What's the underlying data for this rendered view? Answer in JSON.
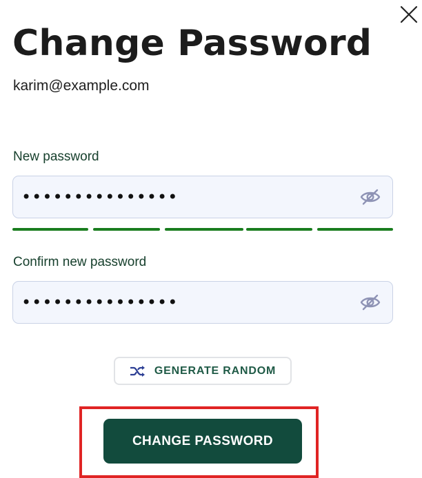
{
  "dialog": {
    "title": "Change Password",
    "email": "karim@example.com",
    "close_icon": "close-icon"
  },
  "new_password": {
    "label": "New password",
    "value": "•••••••••••••••",
    "toggle_icon": "eye-slash-icon"
  },
  "strength": {
    "filled_segments": 5,
    "total_segments": 5,
    "color": "#1a7d1f"
  },
  "confirm_password": {
    "label": "Confirm new password",
    "value": "•••••••••••••••",
    "toggle_icon": "eye-slash-icon"
  },
  "generate": {
    "label": "GENERATE RANDOM",
    "icon": "shuffle-icon"
  },
  "submit": {
    "label": "CHANGE PASSWORD",
    "color": "#124b3d"
  },
  "highlight_color": "#e02424"
}
